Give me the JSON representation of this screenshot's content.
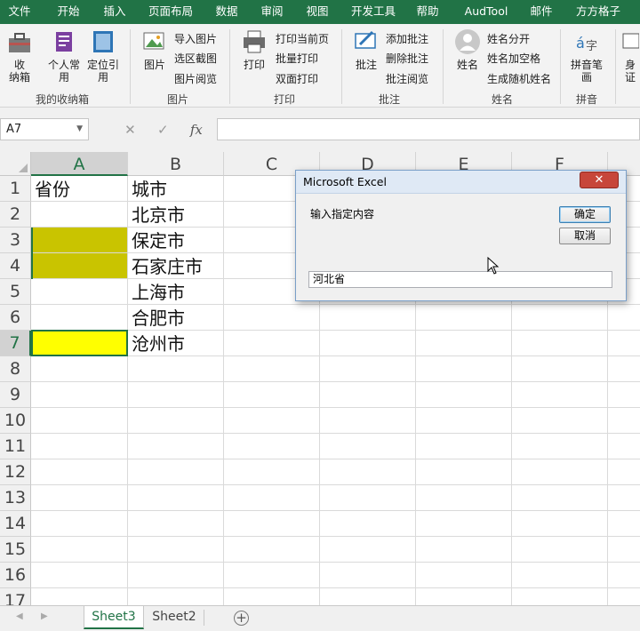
{
  "ribbon_tabs": [
    "文件",
    "开始",
    "插入",
    "页面布局",
    "数据",
    "审阅",
    "视图",
    "开发工具",
    "帮助",
    "AudTool",
    "邮件",
    "方方格子"
  ],
  "ribbon": {
    "groups": {
      "collection": {
        "label": "我的收纳箱",
        "btn_collect": "收\n纳箱",
        "btn_personal": "个人常\n用",
        "btn_locate": "定位引\n用"
      },
      "picture": {
        "label": "图片",
        "btn_picture": "图片",
        "items": [
          "导入图片",
          "选区截图",
          "图片阅览"
        ]
      },
      "print": {
        "label": "打印",
        "btn_print": "打印",
        "items": [
          "打印当前页",
          "批量打印",
          "双面打印"
        ]
      },
      "comment": {
        "label": "批注",
        "btn_comment": "批注",
        "items": [
          "添加批注",
          "删除批注",
          "批注阅览"
        ]
      },
      "name": {
        "label": "姓名",
        "btn_name": "姓名",
        "items": [
          "姓名分开",
          "姓名加空格",
          "生成随机姓名"
        ]
      },
      "pinyin": {
        "label": "拼音",
        "btn_pinyin": "拼音笔\n画"
      },
      "idcard": {
        "btn": "身\n证"
      }
    }
  },
  "formula_bar": {
    "name_box": "A7",
    "cancel_symbol": "✕",
    "enter_symbol": "✓",
    "fx_label": "fx",
    "formula": ""
  },
  "sheet": {
    "columns": [
      "A",
      "B",
      "C",
      "D",
      "E",
      "F"
    ],
    "rows": [
      "1",
      "2",
      "3",
      "4",
      "5",
      "6",
      "7",
      "8",
      "9",
      "10",
      "11",
      "12",
      "13",
      "14",
      "15",
      "16",
      "17"
    ],
    "cells": {
      "A1": "省份",
      "B1": "城市",
      "B2": "北京市",
      "B3": "保定市",
      "B4": "石家庄市",
      "B5": "上海市",
      "B6": "合肥市",
      "B7": "沧州市"
    },
    "selected_cell": "A7",
    "highlight_colors": {
      "olive": "#c9c400",
      "yellow": "#ffff00"
    }
  },
  "sheet_tabs": [
    "Sheet3",
    "Sheet2"
  ],
  "active_sheet": "Sheet3",
  "dialog": {
    "title": "Microsoft Excel",
    "prompt": "输入指定内容",
    "ok_label": "确定",
    "cancel_label": "取消",
    "input_value": "河北省",
    "close_symbol": "✕"
  },
  "colors": {
    "brand_green": "#217346",
    "ribbon_bg": "#f3f3f3"
  }
}
